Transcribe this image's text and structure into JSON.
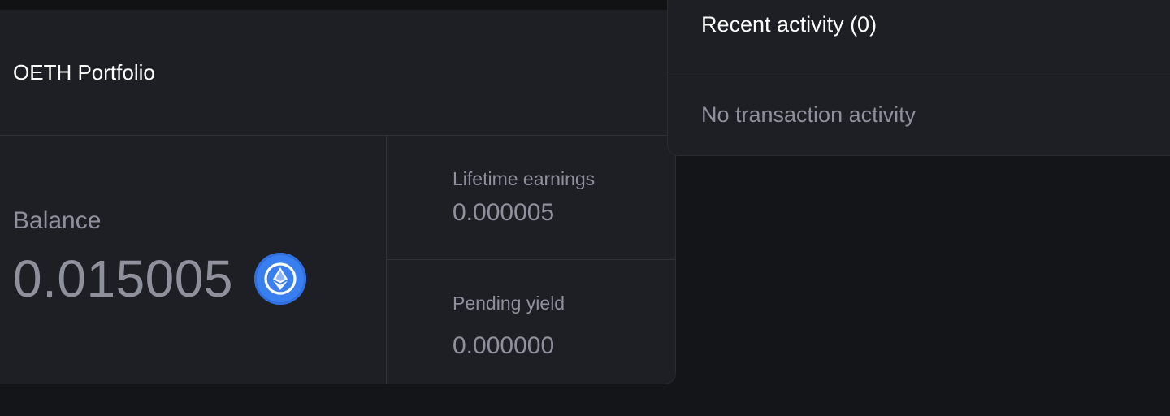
{
  "portfolio": {
    "title": "OETH Portfolio",
    "balance_label": "Balance",
    "balance_value": "0.015005",
    "token_icon": "oeth-token-icon",
    "lifetime_earnings_label": "Lifetime earnings",
    "lifetime_earnings_value": "0.000005",
    "pending_yield_label": "Pending yield",
    "pending_yield_value": "0.000000"
  },
  "activity": {
    "title": "Recent activity (0)",
    "empty_message": "No transaction activity"
  },
  "colors": {
    "background": "#141518",
    "card": "#1e1f25",
    "accent": "#3a7ff0",
    "muted_text": "#8e909c",
    "primary_text": "#ffffff"
  }
}
